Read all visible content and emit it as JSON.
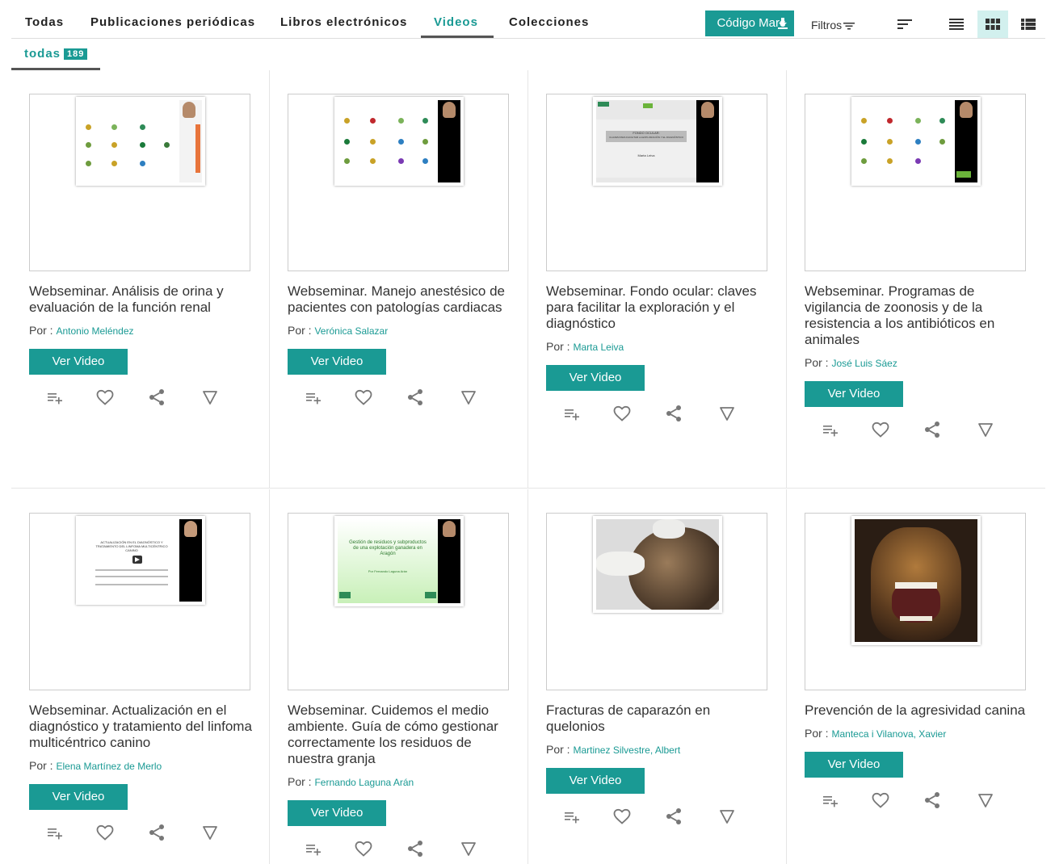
{
  "tabs": [
    {
      "label": "Todas"
    },
    {
      "label": "Publicaciones periódicas"
    },
    {
      "label": "Libros electrónicos"
    },
    {
      "label": "Videos"
    },
    {
      "label": "Colecciones"
    }
  ],
  "toolbar": {
    "marc_label": "Código Marc",
    "filtros_label": "Filtros"
  },
  "subtab": {
    "label": "todas",
    "count": "189"
  },
  "author_prefix": "Por : ",
  "button_label": "Ver Video",
  "accent_color": "#1a9a94",
  "cards": [
    {
      "title": "Webseminar. Análisis de orina y evaluación de la función renal",
      "author": "Antonio Meléndez"
    },
    {
      "title": "Webseminar. Manejo anestésico de pacientes con patologías cardiacas",
      "author": "Verónica Salazar"
    },
    {
      "title": "Webseminar. Fondo ocular: claves para facilitar la exploración y el diagnóstico",
      "author": "Marta Leiva"
    },
    {
      "title": "Webseminar. Programas de vigilancia de zoonosis y de la resistencia a los antibióticos en animales",
      "author": "José Luis Sáez"
    },
    {
      "title": "Webseminar. Actualización en el diagnóstico y tratamiento del linfoma multicéntrico canino",
      "author": "Elena Martínez de Merlo"
    },
    {
      "title": "Webseminar. Cuidemos el medio ambiente. Guía de cómo gestionar correctamente los residuos de nuestra granja",
      "author": "Fernando Laguna Arán"
    },
    {
      "title": "Fracturas de caparazón en quelonios",
      "author": "Martinez Silvestre, Albert"
    },
    {
      "title": "Prevención de la agresividad canina",
      "author": "Manteca i Vilanova, Xavier"
    }
  ],
  "thumb_text": {
    "fondo": "FONDO OCULAR:",
    "fondo2": "CLAVES PARA FACILITAR LA EXPLORACIÓN Y EL DIAGNÓSTICO",
    "marta": "Marta Leiva",
    "linfoma": "ACTUALIZACIÓN EN EL DIAGNÓSTICO Y TRATAMIENTO DEL LINFOMA MULTICÉNTRICO CANINO",
    "gestion": "Gestión de residuos y subproductos de una explotación ganadera en Aragón",
    "laguna": "Por Fernando Laguna Arán"
  },
  "icons": [
    "playlist-add-icon",
    "heart-icon",
    "share-icon",
    "triangle-down-icon",
    "download-icon",
    "filter-icon",
    "sort-icon",
    "list-view-icon",
    "grid-view-icon",
    "detail-view-icon"
  ]
}
